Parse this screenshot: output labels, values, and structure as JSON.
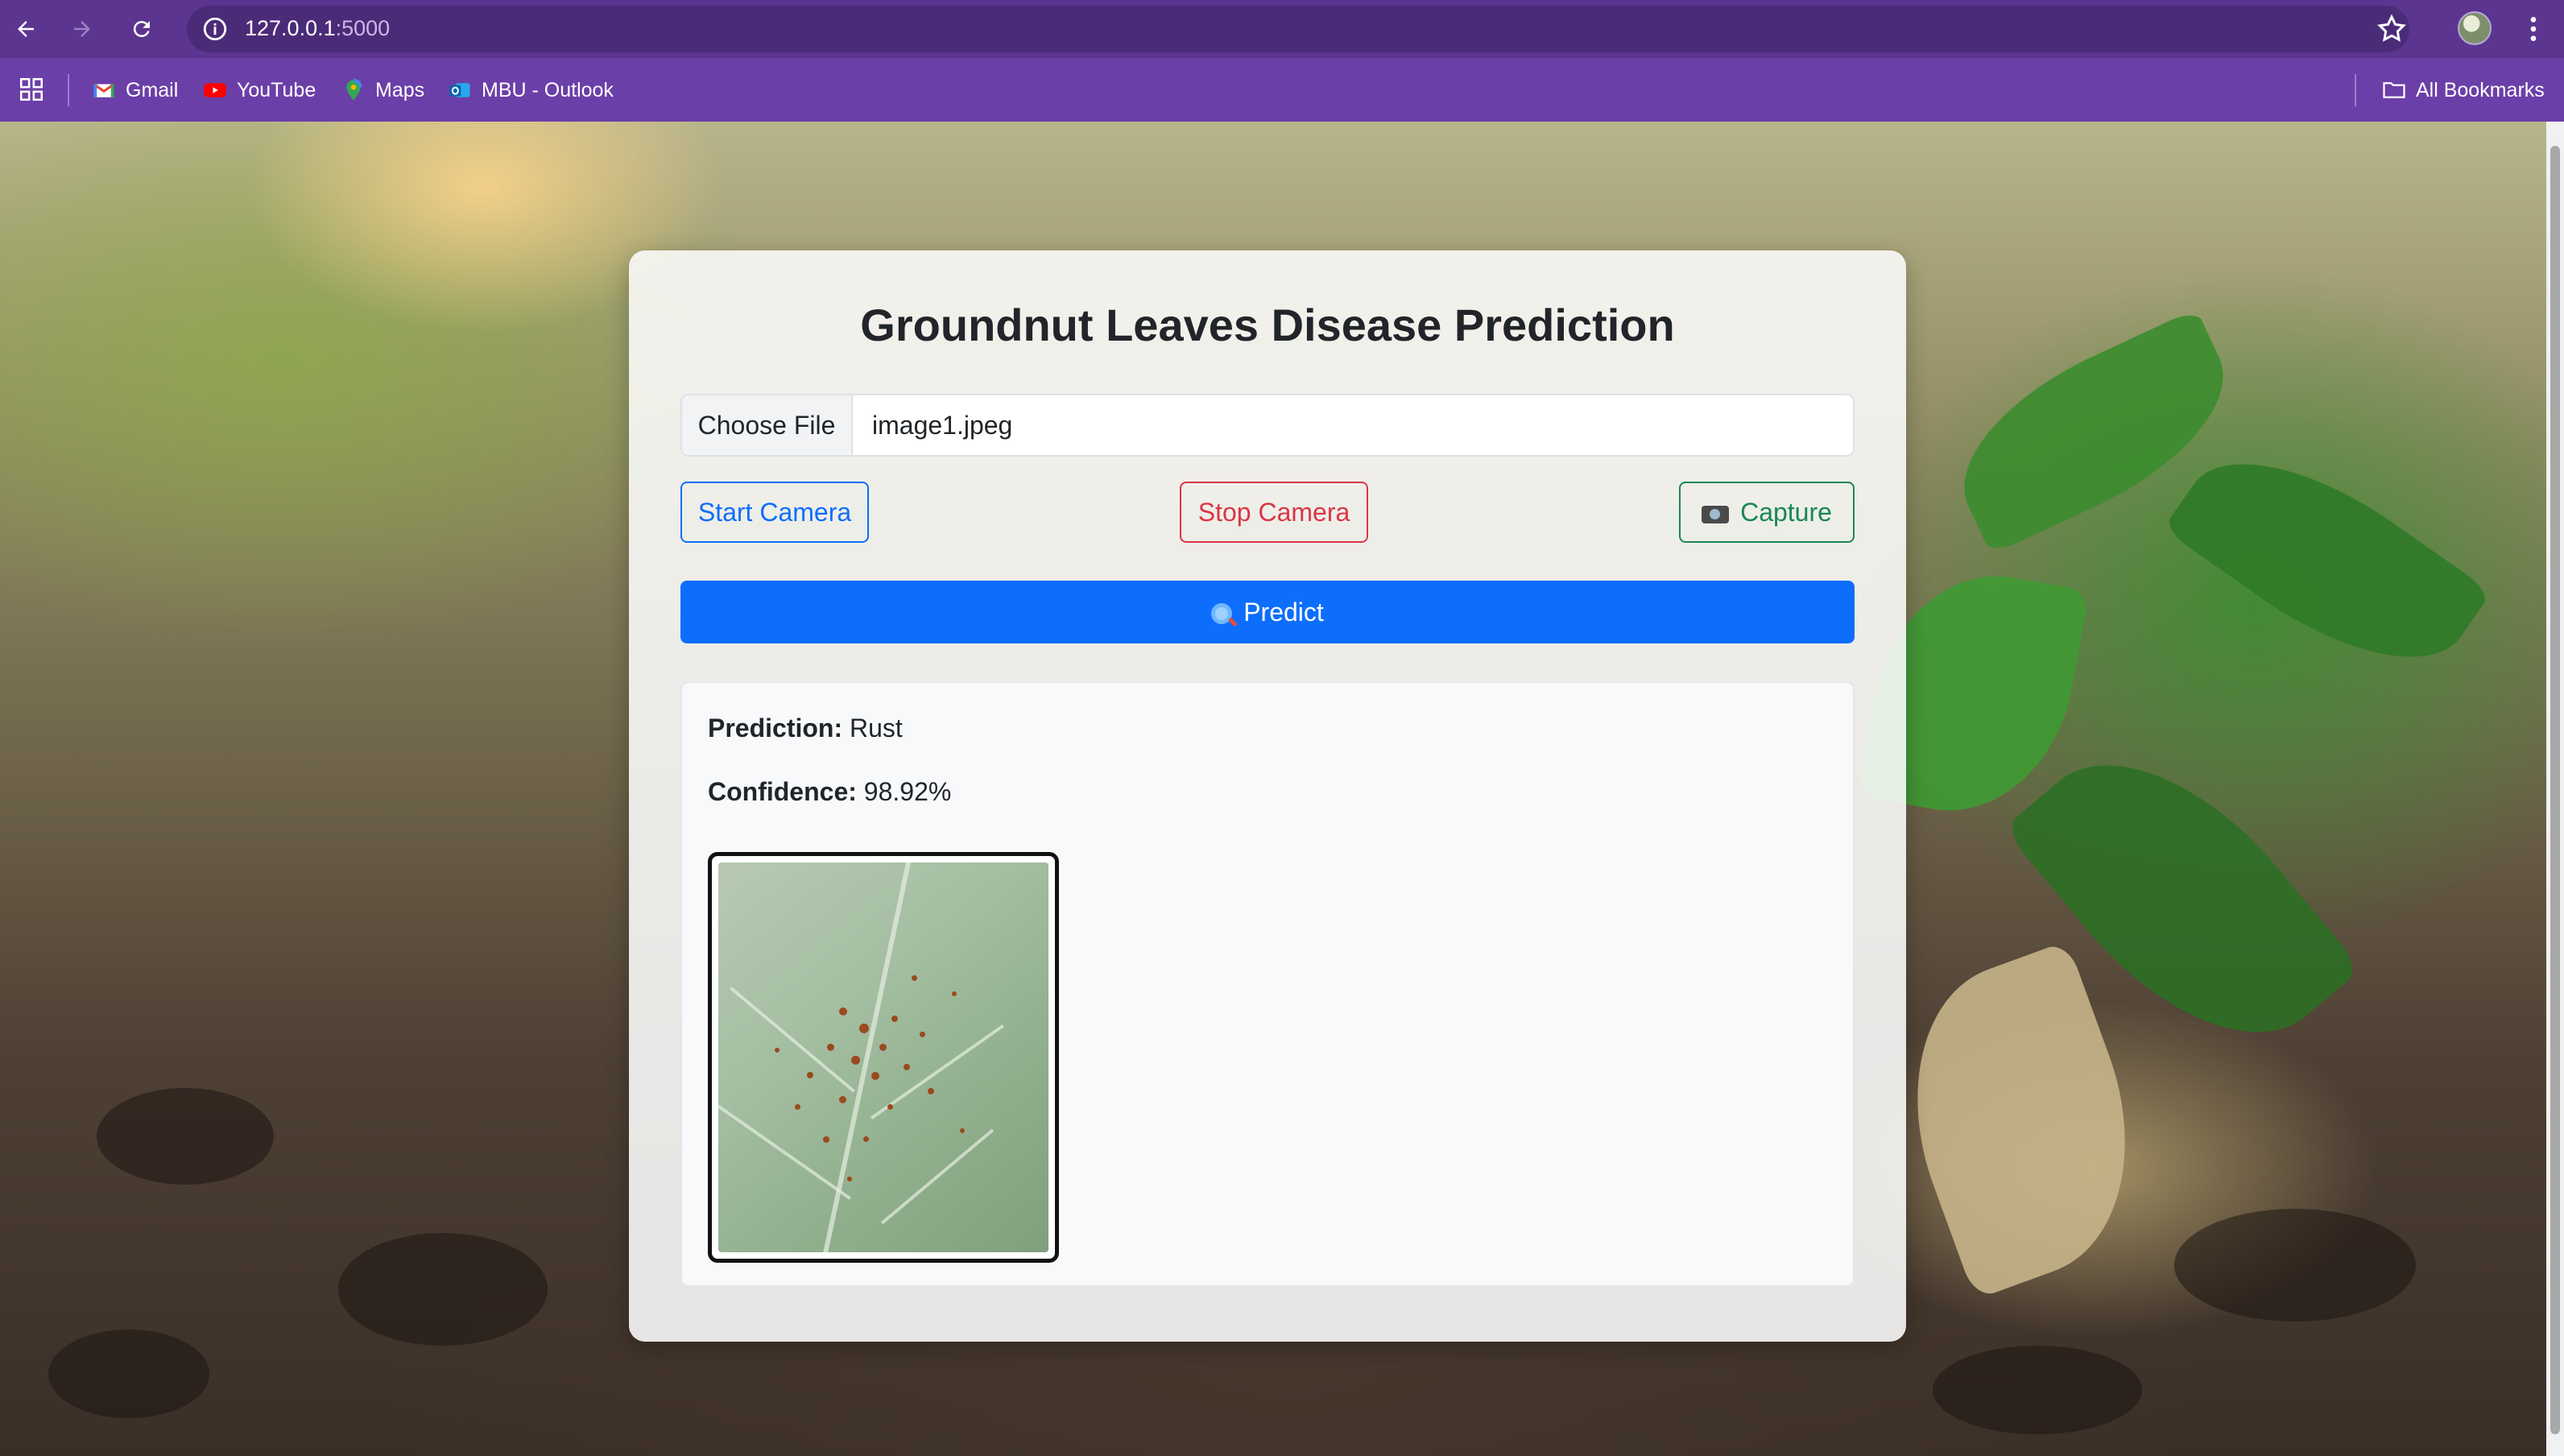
{
  "browser": {
    "url_host": "127.0.0.1",
    "url_port": ":5000",
    "bookmarks": [
      {
        "label": "Gmail",
        "icon": "gmail-icon"
      },
      {
        "label": "YouTube",
        "icon": "youtube-icon"
      },
      {
        "label": "Maps",
        "icon": "maps-icon"
      },
      {
        "label": "MBU - Outlook",
        "icon": "outlook-icon"
      }
    ],
    "all_bookmarks": "All Bookmarks"
  },
  "app": {
    "title": "Groundnut Leaves Disease Prediction",
    "file_input": {
      "button_label": "Choose File",
      "file_name": "image1.jpeg"
    },
    "buttons": {
      "start_camera": "Start Camera",
      "stop_camera": "Stop Camera",
      "capture": "Capture",
      "predict": "Predict"
    },
    "result": {
      "prediction_label": "Prediction:",
      "prediction_value": "Rust",
      "confidence_label": "Confidence:",
      "confidence_value": "98.92%"
    }
  },
  "colors": {
    "primary": "#0d6efd",
    "danger": "#dc3545",
    "success": "#198754",
    "chrome": "#6b3fa8"
  }
}
